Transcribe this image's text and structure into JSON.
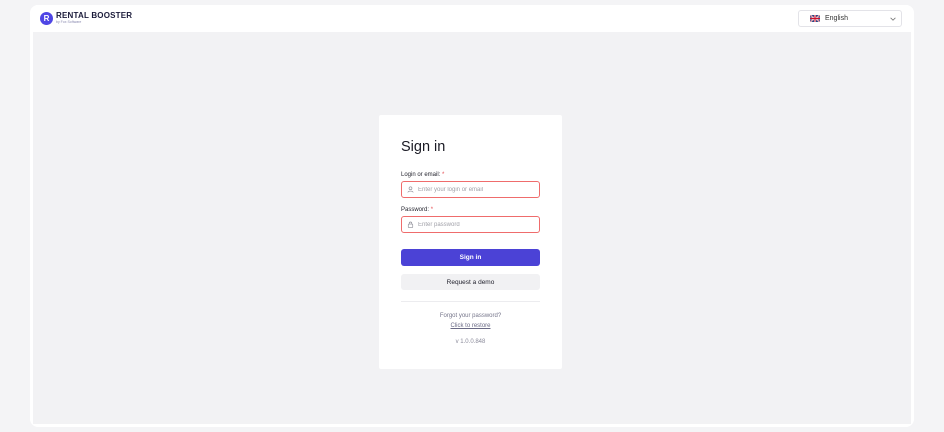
{
  "header": {
    "brand_mark": "R",
    "brand_title": "RENTAL BOOSTER",
    "brand_subtitle": "by Fox Software",
    "language": {
      "selected": "English",
      "flag_icon": "uk-flag-icon"
    }
  },
  "signin": {
    "title": "Sign in",
    "login_label": "Login or email:",
    "login_required": "*",
    "login_placeholder": "Enter your login or email",
    "login_value": "",
    "password_label": "Password:",
    "password_required": "*",
    "password_placeholder": "Enter password",
    "password_value": "",
    "signin_button": "Sign in",
    "demo_button": "Request a demo",
    "forgot_text": "Forgot your password?",
    "restore_link": "Click to restore",
    "version": "v 1.0.0.848"
  },
  "icons": {
    "login": "user-icon",
    "password": "lock-icon",
    "dropdown": "chevron-down-icon"
  },
  "colors": {
    "accent": "#4b42d6",
    "error_border": "#ef6c6c",
    "required": "#e5484d",
    "background": "#f2f2f4"
  }
}
